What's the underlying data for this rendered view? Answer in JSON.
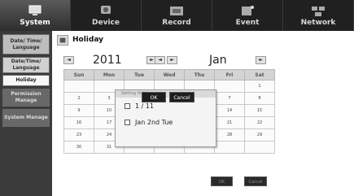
{
  "top_tabs": [
    {
      "label": "System",
      "icon": "system-icon"
    },
    {
      "label": "Device",
      "icon": "device-icon"
    },
    {
      "label": "Record",
      "icon": "record-icon"
    },
    {
      "label": "Event",
      "icon": "event-icon"
    },
    {
      "label": "Network",
      "icon": "network-icon"
    }
  ],
  "sidebar": {
    "items": [
      {
        "label": "Date/ Time/ Language"
      },
      {
        "label": "Date/Time/ Language"
      },
      {
        "label": "Holiday"
      },
      {
        "label": "Permission Manage"
      },
      {
        "label": "System Manage"
      }
    ]
  },
  "page": {
    "title": "Holiday",
    "title_icon": "holiday-icon"
  },
  "calendar": {
    "year": "2011",
    "month": "Jan",
    "prev_label": "◄",
    "next_label": "►",
    "days": [
      "Sun",
      "Mon",
      "Tue",
      "Wed",
      "Thu",
      "Fri",
      "Sat"
    ],
    "weeks": [
      [
        "",
        "",
        "",
        "",
        "",
        "",
        "1"
      ],
      [
        "2",
        "3",
        "",
        "",
        "",
        "7",
        "8"
      ],
      [
        "9",
        "10",
        "",
        "",
        "",
        "14",
        "15"
      ],
      [
        "16",
        "17",
        "",
        "",
        "",
        "21",
        "22"
      ],
      [
        "23",
        "24",
        "",
        "",
        "",
        "28",
        "29"
      ],
      [
        "30",
        "31",
        "",
        "",
        "",
        "",
        ""
      ]
    ]
  },
  "popup": {
    "title": "Setting Holiday",
    "option1": "1 / 11",
    "option2": "Jan 2nd Tue",
    "ok_label": "OK",
    "cancel_label": "Cancel"
  },
  "footer": {
    "ok_label": "OK",
    "cancel_label": "Cancel"
  }
}
